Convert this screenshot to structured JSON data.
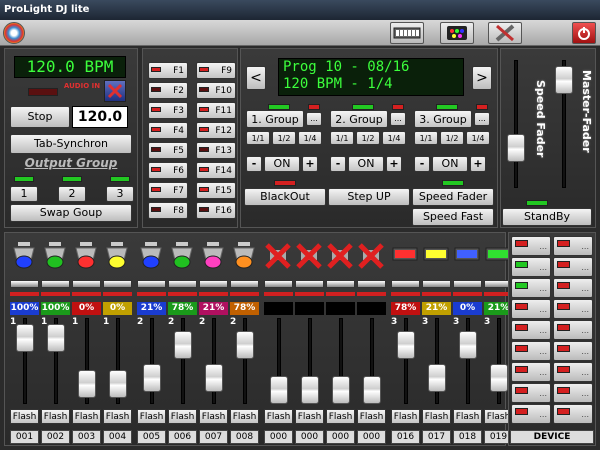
{
  "app": {
    "title": "ProLight DJ lite"
  },
  "colors": {
    "lcd_text": "#3cff3c",
    "lcd_bg": "#0a200a",
    "led_red": "#d42020",
    "led_green": "#22c822"
  },
  "toolbar": {
    "icons": [
      "app-logo-icon",
      "keyboard-icon",
      "dmx-device-icon",
      "tools-icon",
      "power-icon"
    ]
  },
  "bpm": {
    "display": "120.0 BPM",
    "audio_in_label": "AUDIO IN",
    "stop_label": "Stop",
    "value": "120.0",
    "tab_sync_label": "Tab-Synchron",
    "output_group_label": "Output Group",
    "groups": [
      "1",
      "2",
      "3"
    ],
    "swap_label": "Swap Goup"
  },
  "fkeys": {
    "left": [
      "F1",
      "F2",
      "F3",
      "F4",
      "F5",
      "F6",
      "F7",
      "F8"
    ],
    "right": [
      "F9",
      "F10",
      "F11",
      "F12",
      "F13",
      "F14",
      "F15",
      "F16"
    ]
  },
  "program": {
    "line1": "Prog 10 - 08/16",
    "line2": "120 BPM - 1/4",
    "prev": "<",
    "next": ">",
    "groups": [
      {
        "label": "1. Group",
        "more": "..."
      },
      {
        "label": "2. Group",
        "more": "..."
      },
      {
        "label": "3. Group",
        "more": "..."
      }
    ],
    "fractions": [
      "1/1",
      "1/2",
      "1/4"
    ],
    "minus": "-",
    "on": "ON",
    "plus": "+",
    "blackout": "BlackOut",
    "step_up": "Step UP",
    "speed_fader": "Speed Fader",
    "speed_fast": "Speed Fast",
    "standby": "StandBy"
  },
  "faders": {
    "speed_label": "Speed Fader",
    "master_label": "Master-Fader"
  },
  "channels": {
    "flash_label": "Flash",
    "numbers": [
      "001",
      "002",
      "003",
      "004",
      "005",
      "006",
      "007",
      "008",
      "000",
      "000",
      "000",
      "000",
      "016",
      "017",
      "018",
      "019"
    ],
    "values": [
      "100%",
      "100%",
      "0%",
      "0%",
      "21%",
      "78%",
      "21%",
      "78%",
      "",
      "",
      "",
      "",
      "78%",
      "21%",
      "0%",
      "21%"
    ],
    "value_colors": [
      "#1a3cd0",
      "#1a9a1a",
      "#c01010",
      "#c0a000",
      "#1a3cd0",
      "#1a9a1a",
      "#b01060",
      "#c06000",
      "#000",
      "#000",
      "#000",
      "#000",
      "#c01010",
      "#c0a000",
      "#1a3cd0",
      "#1a9a1a"
    ],
    "group_marks": [
      "1",
      "1",
      "1",
      "1",
      "2",
      "2",
      "2",
      "2",
      "",
      "",
      "",
      "",
      "3",
      "3",
      "3",
      "3"
    ],
    "levels": [
      0.9,
      0.9,
      0.1,
      0.1,
      0.2,
      0.78,
      0.2,
      0.78,
      0,
      0,
      0,
      0,
      0.78,
      0.2,
      0.78,
      0.2
    ],
    "icons": [
      "par-light-blue-icon",
      "par-light-green-icon",
      "par-light-red-icon",
      "par-light-yellow-icon",
      "par-light-blue-icon",
      "par-light-green-icon",
      "par-light-magenta-icon",
      "par-light-orange-icon",
      "disabled-x-icon",
      "disabled-x-icon",
      "disabled-x-icon",
      "disabled-x-icon",
      "led-bar-red-icon",
      "led-bar-yellow-icon",
      "led-bar-blue-icon",
      "led-bar-green-icon"
    ],
    "icon_colors": [
      "#2040ff",
      "#20c020",
      "#ff3030",
      "#ffff30",
      "#2040ff",
      "#20c020",
      "#ff40c0",
      "#ff9020",
      "",
      "",
      "",
      "",
      "#ff3030",
      "#ffff30",
      "#4060ff",
      "#30e030"
    ]
  },
  "device": {
    "label": "DEVICE",
    "more": "...",
    "leds": [
      "red",
      "red",
      "green",
      "red",
      "green",
      "red",
      "red",
      "red",
      "red",
      "red",
      "red",
      "red",
      "red",
      "red",
      "red",
      "red",
      "red",
      "red"
    ]
  }
}
